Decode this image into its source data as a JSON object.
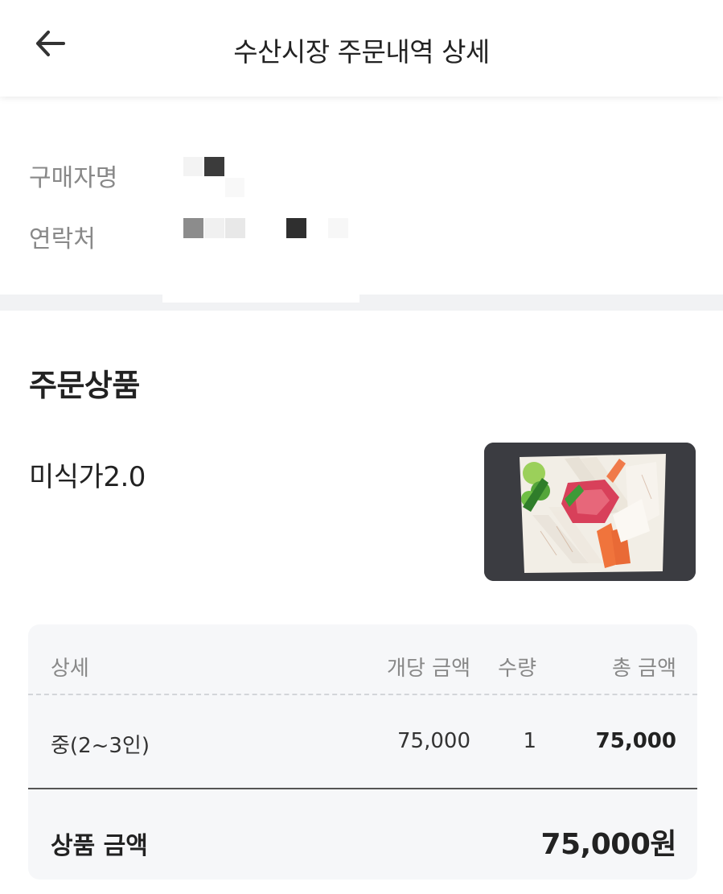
{
  "header": {
    "title": "수산시장 주문내역 상세",
    "back_icon": "arrow-left-icon"
  },
  "buyer": {
    "name_label": "구매자명",
    "phone_label": "연락처"
  },
  "products": {
    "section_title": "주문상품",
    "item_name": "미식가2.0",
    "image_icon": "sashimi-platter-image"
  },
  "detail_table": {
    "headers": {
      "detail": "상세",
      "unit_price": "개당 금액",
      "quantity": "수량",
      "total": "총 금액"
    },
    "rows": [
      {
        "detail": "중(2~3인)",
        "unit_price": "75,000",
        "quantity": "1",
        "total": "75,000"
      }
    ],
    "summary_label": "상품 금액",
    "summary_value": "75,000원"
  }
}
